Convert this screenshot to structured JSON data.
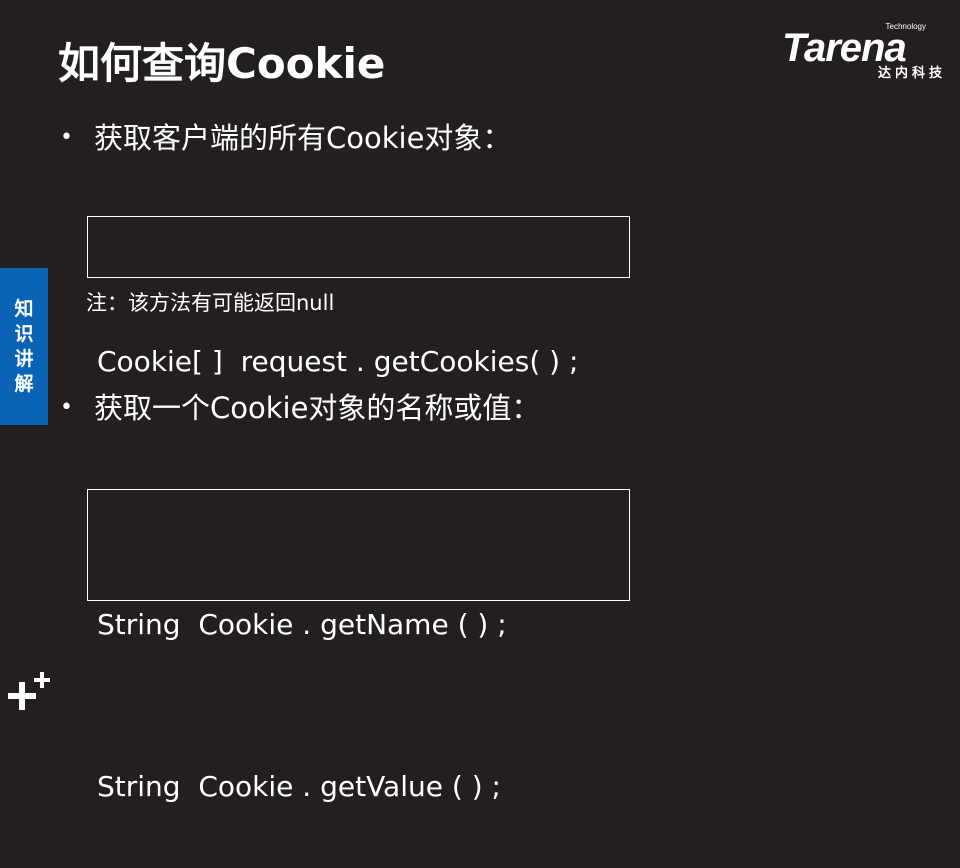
{
  "slide": {
    "title": "如何查询Cookie",
    "logo": {
      "brand": "Tarena",
      "tagline": "Technology",
      "cn": "达内科技"
    },
    "side_tab": "知识讲解",
    "sections": [
      {
        "bullet": "•",
        "heading": "获取客户端的所有Cookie对象：",
        "code": [
          "Cookie[ ]  request . getCookies( ) ;"
        ],
        "note": "注：该方法有可能返回null"
      },
      {
        "bullet": "•",
        "heading": "获取一个Cookie对象的名称或值：",
        "code": [
          "String  Cookie . getName ( ) ;",
          "String  Cookie . getValue ( ) ;"
        ]
      }
    ],
    "colors": {
      "background": "#231f20",
      "text": "#ffffff",
      "side_tab": "#0b63b6"
    }
  }
}
